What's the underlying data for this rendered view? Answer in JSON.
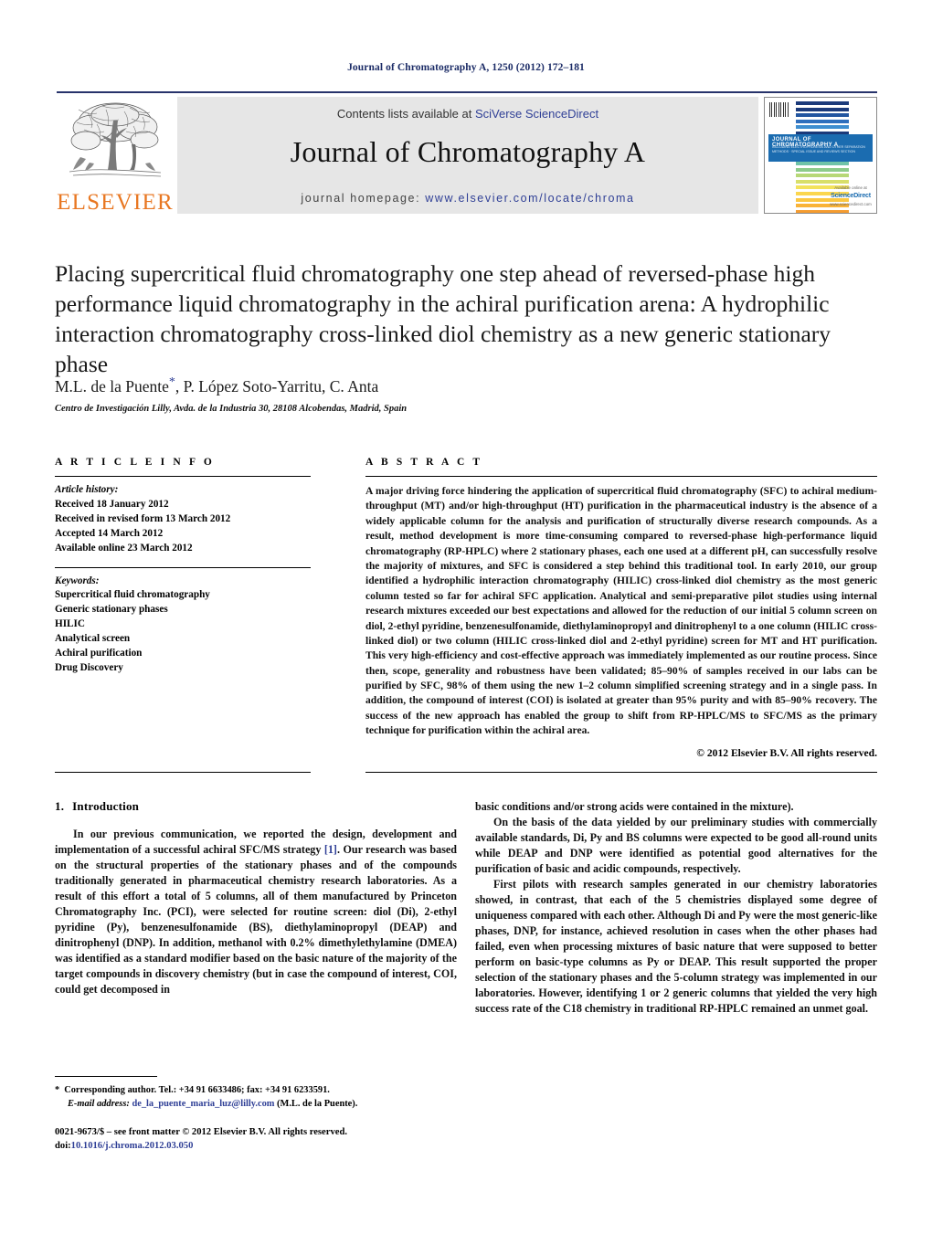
{
  "running_head": "Journal of Chromatography A, 1250 (2012) 172–181",
  "masthead": {
    "contents_prefix": "Contents lists available at ",
    "contents_link": "SciVerse ScienceDirect",
    "journal_title": "Journal of Chromatography A",
    "homepage_prefix": "journal homepage: ",
    "homepage_url": "www.elsevier.com/locate/chroma",
    "publisher": "ELSEVIER",
    "publisher_logo_color": "#E87722",
    "accent_color": "#2f3f96",
    "cover": {
      "band_title": "JOURNAL OF CHROMATOGRAPHY A",
      "band_subtitle": "INCLUDING ELECTROPHORESIS AND OTHER SEPARATION METHODS · SPECIAL ISSUE AND REVIEWS SECTION",
      "logo_mark": "ScienceDirect",
      "logo_caption_top": "Available online at",
      "logo_caption_bottom": "www.sciencedirect.com",
      "bar_colors": [
        "#1b3a7a",
        "#1b3a7a",
        "#2255a0",
        "#2f6fbd",
        "#3f8ed0",
        "#1b3a7a",
        "#2f6fbd",
        "#4aa3d8",
        "#58b4d4",
        "#62bcc6",
        "#6fc3a8",
        "#8dcb8a",
        "#b7d877",
        "#d8df6a",
        "#f3e25c",
        "#fbd64f",
        "#fbc742",
        "#f9b338",
        "#f59c30",
        "#f08428",
        "#ea6b22",
        "#e4521d",
        "#dc3b1b",
        "#d12a1a"
      ]
    }
  },
  "article": {
    "title": "Placing supercritical fluid chromatography one step ahead of reversed-phase high performance liquid chromatography in the achiral purification arena: A hydrophilic interaction chromatography cross-linked diol chemistry as a new generic stationary phase",
    "authors": "M.L. de la Puente",
    "authors_rest": ", P. López Soto-Yarritu, C. Anta",
    "corresponding_marker": "*",
    "affiliation": "Centro de Investigación Lilly, Avda. de la Industria 30, 28108 Alcobendas, Madrid, Spain"
  },
  "article_info": {
    "heading": "A R T I C L E   I N F O",
    "history_label": "Article history:",
    "history": [
      "Received 18 January 2012",
      "Received in revised form 13 March 2012",
      "Accepted 14 March 2012",
      "Available online 23 March 2012"
    ],
    "keywords_label": "Keywords:",
    "keywords": [
      "Supercritical fluid chromatography",
      "Generic stationary phases",
      "HILIC",
      "Analytical screen",
      "Achiral purification",
      "Drug Discovery"
    ]
  },
  "abstract": {
    "heading": "A B S T R A C T",
    "text": "A major driving force hindering the application of supercritical fluid chromatography (SFC) to achiral medium-throughput (MT) and/or high-throughput (HT) purification in the pharmaceutical industry is the absence of a widely applicable column for the analysis and purification of structurally diverse research compounds. As a result, method development is more time-consuming compared to reversed-phase high-performance liquid chromatography (RP-HPLC) where 2 stationary phases, each one used at a different pH, can successfully resolve the majority of mixtures, and SFC is considered a step behind this traditional tool. In early 2010, our group identified a hydrophilic interaction chromatography (HILIC) cross-linked diol chemistry as the most generic column tested so far for achiral SFC application. Analytical and semi-preparative pilot studies using internal research mixtures exceeded our best expectations and allowed for the reduction of our initial 5 column screen on diol, 2-ethyl pyridine, benzenesulfonamide, diethylaminopropyl and dinitrophenyl to a one column (HILIC cross-linked diol) or two column (HILIC cross-linked diol and 2-ethyl pyridine) screen for MT and HT purification. This very high-efficiency and cost-effective approach was immediately implemented as our routine process. Since then, scope, generality and robustness have been validated; 85–90% of samples received in our labs can be purified by SFC, 98% of them using the new 1–2 column simplified screening strategy and in a single pass. In addition, the compound of interest (COI) is isolated at greater than 95% purity and with 85–90% recovery. The success of the new approach has enabled the group to shift from RP-HPLC/MS to SFC/MS as the primary technique for purification within the achiral area.",
    "copyright": "© 2012 Elsevier B.V. All rights reserved."
  },
  "body": {
    "section_number": "1.",
    "section_title": "Introduction",
    "left_para_1_a": "In our previous communication, we reported the design, development and implementation of a successful achiral SFC/MS strategy ",
    "left_para_1_ref": "[1]",
    "left_para_1_b": ". Our research was based on the structural properties of the stationary phases and of the compounds traditionally generated in pharmaceutical chemistry research laboratories. As a result of this effort a total of 5 columns, all of them manufactured by Princeton Chromatography Inc. (PCI), were selected for routine screen: diol (Di), 2-ethyl pyridine (Py), benzenesulfonamide (BS), diethylaminopropyl (DEAP) and dinitrophenyl (DNP). In addition, methanol with 0.2% dimethylethylamine (DMEA) was identified as a standard modifier based on the basic nature of the majority of the target compounds in discovery chemistry (but in case the compound of interest, COI, could get decomposed in",
    "right_para_0": "basic conditions and/or strong acids were contained in the mixture).",
    "right_para_1": "On the basis of the data yielded by our preliminary studies with commercially available standards, Di, Py and BS columns were expected to be good all-round units while DEAP and DNP were identified as potential good alternatives for the purification of basic and acidic compounds, respectively.",
    "right_para_2": "First pilots with research samples generated in our chemistry laboratories showed, in contrast, that each of the 5 chemistries displayed some degree of uniqueness compared with each other. Although Di and Py were the most generic-like phases, DNP, for instance, achieved resolution in cases when the other phases had failed, even when processing mixtures of basic nature that were supposed to better perform on basic-type columns as Py or DEAP. This result supported the proper selection of the stationary phases and the 5-column strategy was implemented in our laboratories. However, identifying 1 or 2 generic columns that yielded the very high success rate of the C18 chemistry in traditional RP-HPLC remained an unmet goal."
  },
  "footnote": {
    "marker": "*",
    "corresponding": "Corresponding author. Tel.: +34 91 6633486; fax: +34 91 6233591.",
    "email_label": "E-mail address:",
    "email": "de_la_puente_maria_luz@lilly.com",
    "email_suffix": " (M.L. de la Puente)."
  },
  "imprint": {
    "issn_line": "0021-9673/$ – see front matter © 2012 Elsevier B.V. All rights reserved.",
    "doi_label": "doi:",
    "doi": "10.1016/j.chroma.2012.03.050"
  }
}
